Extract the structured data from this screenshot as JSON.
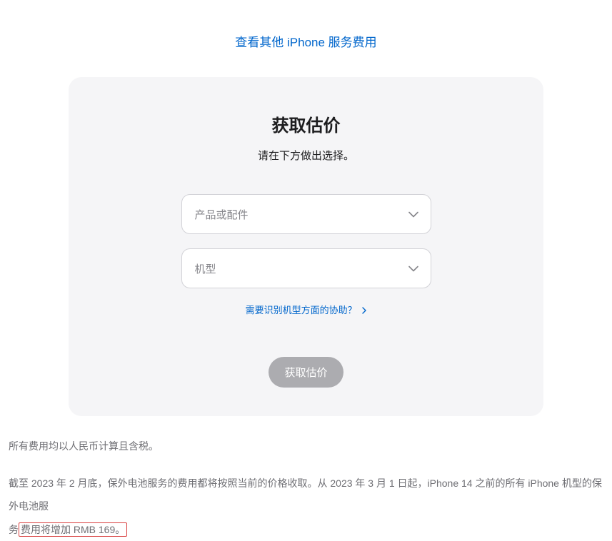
{
  "topLink": "查看其他 iPhone 服务费用",
  "card": {
    "title": "获取估价",
    "subtitle": "请在下方做出选择。",
    "selectProduct": "产品或配件",
    "selectModel": "机型",
    "helpLink": "需要识别机型方面的协助？",
    "submit": "获取估价"
  },
  "disclaimer": {
    "line1": "所有费用均以人民币计算且含税。",
    "line2a": "截至 2023 年 2 月底，保外电池服务的费用都将按照当前的价格收取。从 2023 年 3 月 1 日起，iPhone 14 之前的所有 iPhone 机型的保外电池服",
    "line2b_prefix": "务",
    "line2b_highlight": "费用将增加 RMB 169。"
  }
}
